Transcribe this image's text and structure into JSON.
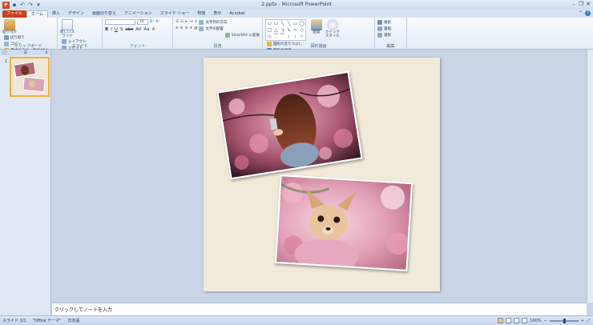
{
  "window": {
    "title": "2.pptx - Microsoft PowerPoint",
    "app_icon": "P"
  },
  "tabs": [
    {
      "label": "ファイル"
    },
    {
      "label": "ホーム"
    },
    {
      "label": "挿入"
    },
    {
      "label": "デザイン"
    },
    {
      "label": "画面切り替え"
    },
    {
      "label": "アニメーション"
    },
    {
      "label": "スライド ショー"
    },
    {
      "label": "校閲"
    },
    {
      "label": "表示"
    },
    {
      "label": "Acrobat"
    }
  ],
  "ribbon": {
    "clipboard": {
      "label": "クリップボード",
      "paste": "貼り付け",
      "cut": "切り取り",
      "copy": "コピー",
      "format_painter": "書式のコピー/貼り付け"
    },
    "slides": {
      "label": "スライド",
      "new_slide": "新しいスライド",
      "layout": "レイアウト",
      "reset": "リセット",
      "section": "セクション"
    },
    "font": {
      "label": "フォント",
      "size": "10",
      "buttons": [
        "B",
        "I",
        "U",
        "S",
        "abc",
        "AV",
        "Aa",
        "A"
      ]
    },
    "paragraph": {
      "label": "段落",
      "text_direction": "文字列の方向",
      "align_text": "文字の配置",
      "smartart": "SmartArt に変換"
    },
    "drawing": {
      "label": "図形描画",
      "arrange": "配置",
      "quick_styles": "クイック スタイル",
      "shape_fill": "図形の塗りつぶし",
      "shape_outline": "図形の枠線",
      "shape_effects": "図形の効果"
    },
    "editing": {
      "label": "編集",
      "find": "検索",
      "replace": "置換",
      "select": "選択"
    }
  },
  "left_pane": {
    "slide_number": "1"
  },
  "notes": {
    "placeholder": "クリックしてノートを入力"
  },
  "status": {
    "slide": "スライド 1/1",
    "theme": "\"Office テーマ\"",
    "language": "日本語",
    "zoom": "100%"
  },
  "colors": {
    "file_tab": "#c8421b",
    "slide_bg": "#f1e9da",
    "editor_bg": "#c9d5e4"
  }
}
